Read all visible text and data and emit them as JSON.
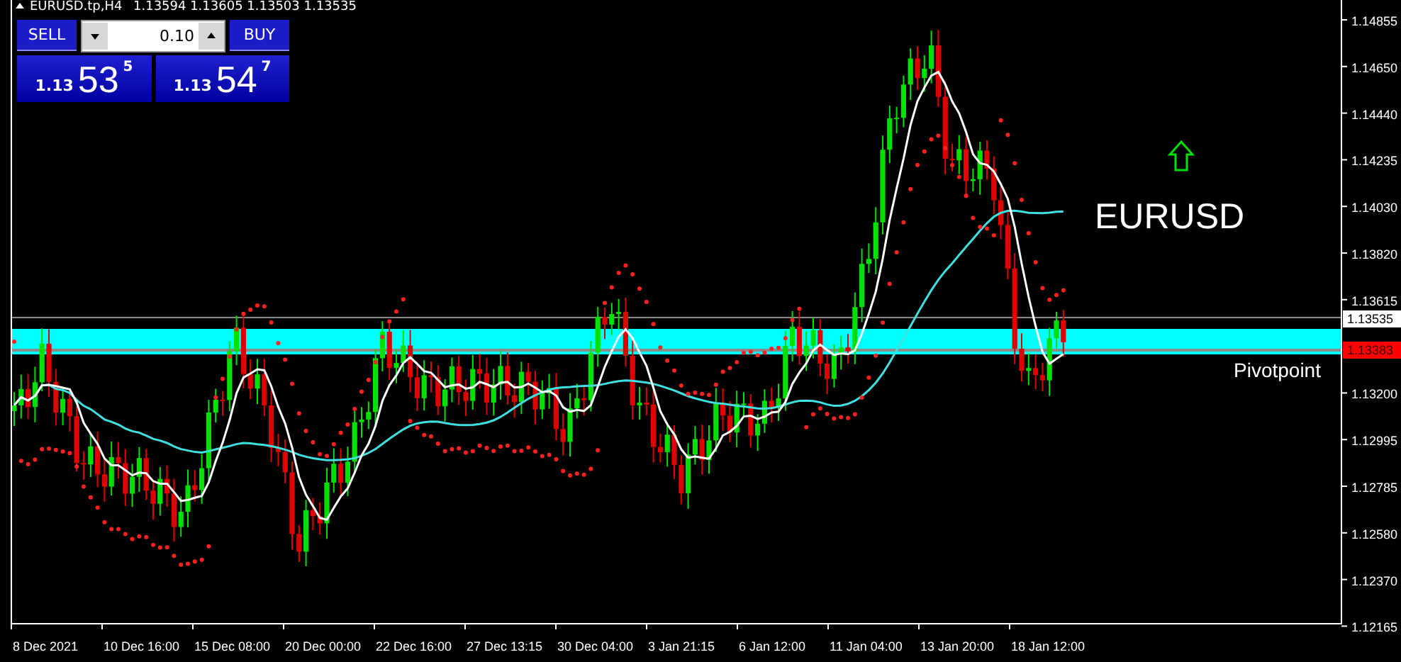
{
  "header": {
    "symbol": "EURUSD.tp,H4",
    "quotes": "1.13594 1.13605 1.13503 1.13535"
  },
  "trade_panel": {
    "sell_label": "SELL",
    "buy_label": "BUY",
    "lot": "0.10",
    "sell_price": {
      "prefix": "1.13",
      "big": "53",
      "small": "5"
    },
    "buy_price": {
      "prefix": "1.13",
      "big": "54",
      "small": "7"
    }
  },
  "overlay": {
    "symbol": "EURUSD",
    "pivot_label": "Pivotpoint"
  },
  "price_axis": [
    "1.14855",
    "1.14650",
    "1.14440",
    "1.14235",
    "1.14030",
    "1.13820",
    "1.13615",
    "1.13200",
    "1.12995",
    "1.12785",
    "1.12580",
    "1.12370",
    "1.12165"
  ],
  "price_markers": [
    {
      "kind": "current",
      "label": "1.13535"
    },
    {
      "kind": "pivot",
      "label": "1.13383"
    }
  ],
  "time_axis": [
    "8 Dec 2021",
    "10 Dec 16:00",
    "15 Dec 08:00",
    "20 Dec 00:00",
    "22 Dec 16:00",
    "27 Dec 13:15",
    "30 Dec 04:00",
    "3 Jan 21:15",
    "6 Jan 12:00",
    "11 Jan 04:00",
    "13 Jan 20:00",
    "18 Jan 12:00"
  ]
}
